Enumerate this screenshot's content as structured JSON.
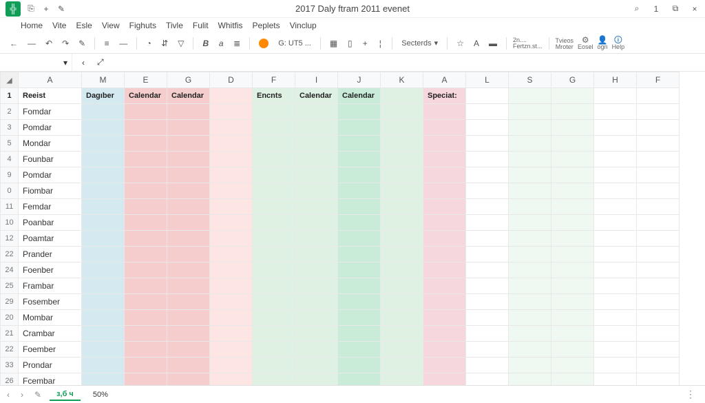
{
  "title": "2017 Daly ftram 2011 evenet",
  "titlebar_icons": {
    "doc": "⎘",
    "plus": "+",
    "edit": "✎"
  },
  "titlebar_right": {
    "search": "⌕",
    "one": "1",
    "window": "⧉",
    "close": "×"
  },
  "menus": [
    "Home",
    "Vite",
    "Esle",
    "View",
    "Fighuts",
    "Tivle",
    "Fulit",
    "Whitfis",
    "Peplets",
    "Vinclup"
  ],
  "toolbar": {
    "arrow_l": "←",
    "arrow_r": "—",
    "undo": "↶",
    "redo": "↷",
    "brush": "✎",
    "align": "≡",
    "dash": "—",
    "clock": "◔",
    "filter": "⇵",
    "funnel": "▽",
    "bold": "B",
    "italic": "a",
    "list": "≣",
    "code_label": "G: UT5 ...",
    "grid": "▦",
    "col": "▯",
    "plus": "+",
    "vdash": "¦",
    "selector": "Secterds",
    "star": "☆",
    "fill": "A",
    "paint": "▬",
    "group2_a": "2n....",
    "group2_b": "Fertzn.st...",
    "group3_a": "Tvieos",
    "group3_b": "Mroter",
    "group3_c": "Eosel",
    "group3_d": "ogn",
    "group3_e": "Help",
    "icon_red": "🔴",
    "icon_person": "👤",
    "icon_blue": "🟦"
  },
  "formulabar": {
    "dropdown": "▾",
    "back": "‹",
    "expand": "⤢",
    "cell": ""
  },
  "columns": [
    "A",
    "M",
    "E",
    "G",
    "D",
    "F",
    "I",
    "J",
    "K",
    "A",
    "L",
    "S",
    "G",
    "H",
    "F"
  ],
  "header_row": [
    "Reeist",
    "Dagıber",
    "Calendar",
    "Calendar",
    "",
    "Encnts",
    "Calendar",
    "Calendar",
    "",
    "Speciat:",
    "",
    "",
    "",
    "",
    ""
  ],
  "row_numbers": [
    "1",
    "2",
    "3",
    "5",
    "4",
    "9",
    "0",
    "11",
    "10",
    "12",
    "22",
    "24",
    "25",
    "29",
    "20",
    "21",
    "22",
    "33",
    "26"
  ],
  "rows_colA": [
    "Fomdar",
    "Pomdar",
    "Mondar",
    "Founbar",
    "Pomdar",
    "Fiombar",
    "Femdar",
    "Poanbar",
    "Poamtar",
    "Prander",
    "Foenber",
    "Frambar",
    "Fosember",
    "Mombar",
    "Crambar",
    "Foember",
    "Prondar",
    "Fcembar"
  ],
  "colorScheme": [
    "",
    "c-blue",
    "c-pink",
    "c-pink",
    "c-lpink",
    "c-green",
    "c-green",
    "c-mint",
    "c-green",
    "c-rose",
    "",
    "c-vlgreen",
    "c-vlgreen",
    "",
    ""
  ],
  "sheets": {
    "prev": "‹",
    "next": "›",
    "icon": "✎",
    "tab1": "з,б ч",
    "tab2": "50%"
  }
}
